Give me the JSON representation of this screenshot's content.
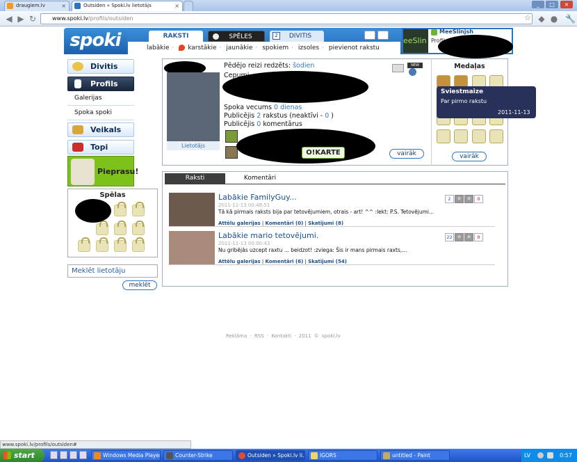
{
  "browser": {
    "tabs": [
      {
        "title": "draugiem.lv"
      },
      {
        "title": "Outsiden » Spoki.lv lietotājs"
      }
    ],
    "url_host": "www.spoki.lv",
    "url_path": "/profils/outsiden"
  },
  "site": {
    "logo_text": "spoki",
    "main_tabs": [
      "RAKSTI",
      "SPĒLES",
      "DIVITIS"
    ],
    "subnav": [
      "labākie",
      "karstākie",
      "jaunākie",
      "spokiem",
      "izsoles",
      "pievienot rakstu"
    ],
    "user": {
      "avatar_text": "eeSlin",
      "name": "MeeSlinjsh",
      "menu": "Profils"
    }
  },
  "sidebar": {
    "divitis": "Divitis",
    "profils": "Profils",
    "sub": [
      "Galerijas",
      "Spoka spoki"
    ],
    "veikals": "Veikals",
    "topi": "Topi",
    "pieprasu": "Pieprasu!",
    "games_title": "Spēlas",
    "search_placeholder": "Meklēt lietotāju",
    "search_button": "meklēt"
  },
  "profile": {
    "photo_label": "Lietotājs",
    "last_seen_label": "Pēdējo reizi redzēts:",
    "last_seen_value": "šodien",
    "cepumi_label": "Cepumi",
    "age_label": "Spoka vecums",
    "age_value": "0 dienas",
    "pub_label": "Publicējis",
    "pub_count": "2",
    "pub_mid": "rakstus (neaktīvi -",
    "pub_inactive": "0",
    "pub_end": ")",
    "comments_label": "Publicējis",
    "comments_count": "0",
    "comments_end": "komentārus",
    "okarte": "O!KARTE",
    "more": "vairāk",
    "badge": "NEW"
  },
  "medals": {
    "title": "Medaļas",
    "more": "vairāk",
    "tooltip_title": "Sviestmaize",
    "tooltip_desc": "Par pirmo rakstu",
    "tooltip_date": "2011-11-13"
  },
  "content_tabs": [
    "Raksti",
    "Komentāri"
  ],
  "articles": [
    {
      "title": "Labākie FamilyGuy...",
      "date": "2011-11-13 00:48:51",
      "desc": "Tā kā pirmais raksts bija par tetovējumiem, otrais - art! ^^ :lekt: P.S. Tetovējumi...",
      "gallery": "Attēlu galerijas",
      "comments": "Komentāri (0)",
      "views": "Skatījumi (8)",
      "rate_left": "2",
      "rate_right": "0"
    },
    {
      "title": "Labākie mario tetovējumi.",
      "date": "2011-11-13 00:00:43",
      "desc": "Nu gribējās uzcept raxtu ... beidzot! :zviega: Šis ir mans pirmais raxts,...",
      "gallery": "Attēlu galerijas",
      "comments": "Komentāri (6)",
      "views": "Skatījumi (54)",
      "rate_left": "22",
      "rate_right": "0"
    }
  ],
  "footer": "Reklāma · RSS · Kontakti · 2011 © spoki.lv",
  "status_url": "www.spoki.lv/profils/outsiden#",
  "taskbar": {
    "start": "start",
    "buttons": [
      "Windows Media Player",
      "Counter-Strike",
      "Outsiden » Spoki.lv li...",
      "IGORS",
      "untitled - Paint"
    ],
    "lang": "LV",
    "clock": "0:57"
  },
  "colors": {
    "brand_blue": "#2b74c2",
    "nav_dark": "#17263d",
    "pieprasu_green": "#7ec11b",
    "taskbar_blue": "#245edb"
  }
}
